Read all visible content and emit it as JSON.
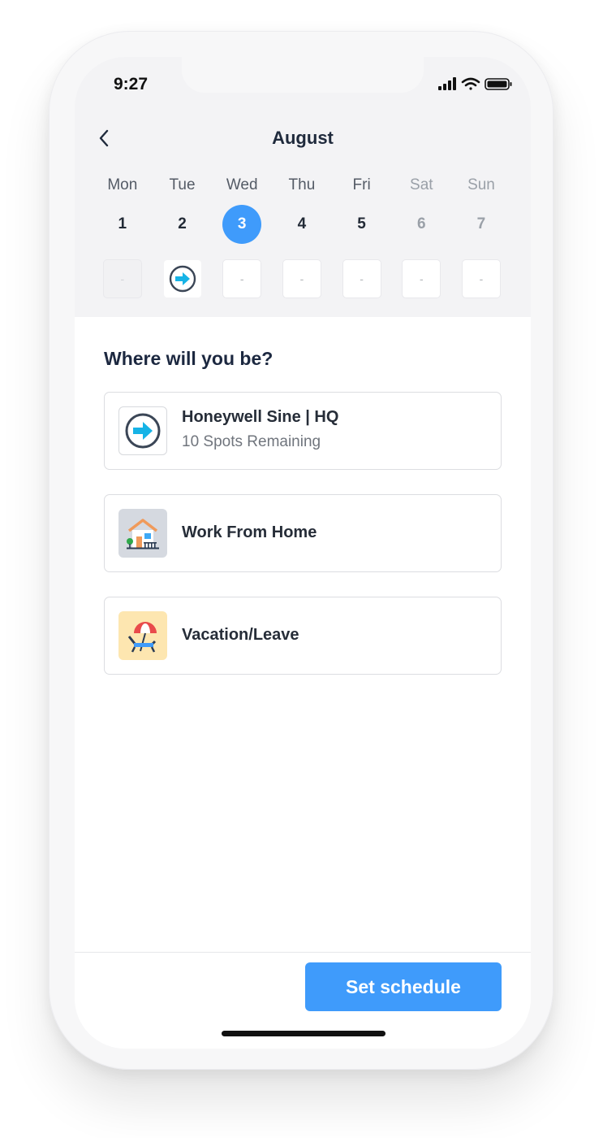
{
  "status_bar": {
    "time": "9:27"
  },
  "header": {
    "month": "August"
  },
  "week": [
    {
      "name": "Mon",
      "num": "1",
      "slot": "-",
      "slot_state": "disabled",
      "selected": false,
      "weekend": false
    },
    {
      "name": "Tue",
      "num": "2",
      "slot": "",
      "slot_state": "office",
      "selected": false,
      "weekend": false
    },
    {
      "name": "Wed",
      "num": "3",
      "slot": "-",
      "slot_state": "empty",
      "selected": true,
      "weekend": false
    },
    {
      "name": "Thu",
      "num": "4",
      "slot": "-",
      "slot_state": "empty",
      "selected": false,
      "weekend": false
    },
    {
      "name": "Fri",
      "num": "5",
      "slot": "-",
      "slot_state": "empty",
      "selected": false,
      "weekend": false
    },
    {
      "name": "Sat",
      "num": "6",
      "slot": "-",
      "slot_state": "empty",
      "selected": false,
      "weekend": true
    },
    {
      "name": "Sun",
      "num": "7",
      "slot": "-",
      "slot_state": "empty",
      "selected": false,
      "weekend": true
    }
  ],
  "main": {
    "question": "Where will you be?",
    "options": [
      {
        "title": "Honeywell Sine | HQ",
        "subtitle": "10 Spots Remaining",
        "icon": "office-arrow-icon"
      },
      {
        "title": "Work From Home",
        "icon": "house-icon"
      },
      {
        "title": "Vacation/Leave",
        "icon": "beach-chair-icon"
      }
    ]
  },
  "footer": {
    "button_label": "Set schedule"
  },
  "colors": {
    "accent": "#3f9bfb",
    "header_bg": "#f3f3f5",
    "heading": "#1c2840"
  }
}
